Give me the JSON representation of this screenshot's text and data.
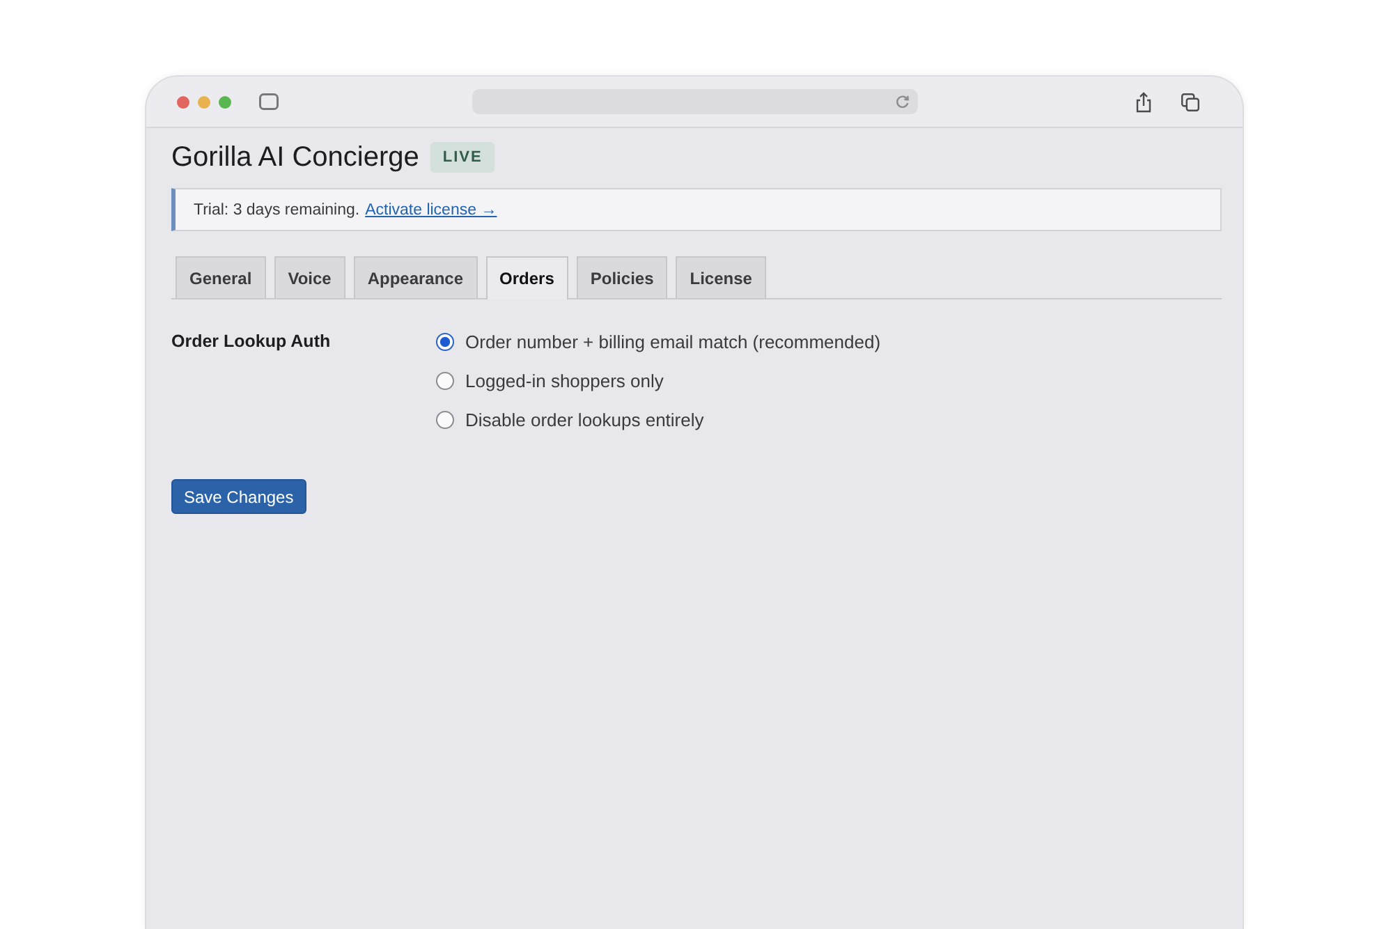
{
  "header": {
    "title": "Gorilla AI Concierge",
    "badge": "LIVE"
  },
  "notice": {
    "text": "Trial: 3 days remaining.",
    "link": "Activate license →"
  },
  "tabs": [
    {
      "label": "General",
      "selected": false
    },
    {
      "label": "Voice",
      "selected": false
    },
    {
      "label": "Appearance",
      "selected": false
    },
    {
      "label": "Orders",
      "selected": true
    },
    {
      "label": "Policies",
      "selected": false
    },
    {
      "label": "License",
      "selected": false
    }
  ],
  "settings": [
    {
      "label": "Order Lookup Auth",
      "kind": "radio",
      "options": [
        {
          "label": "Order number + billing email match (recommended)",
          "selected": true
        },
        {
          "label": "Logged-in shoppers only",
          "selected": false
        },
        {
          "label": "Disable order lookups entirely",
          "selected": false
        }
      ]
    }
  ],
  "save_button": "Save Changes"
}
